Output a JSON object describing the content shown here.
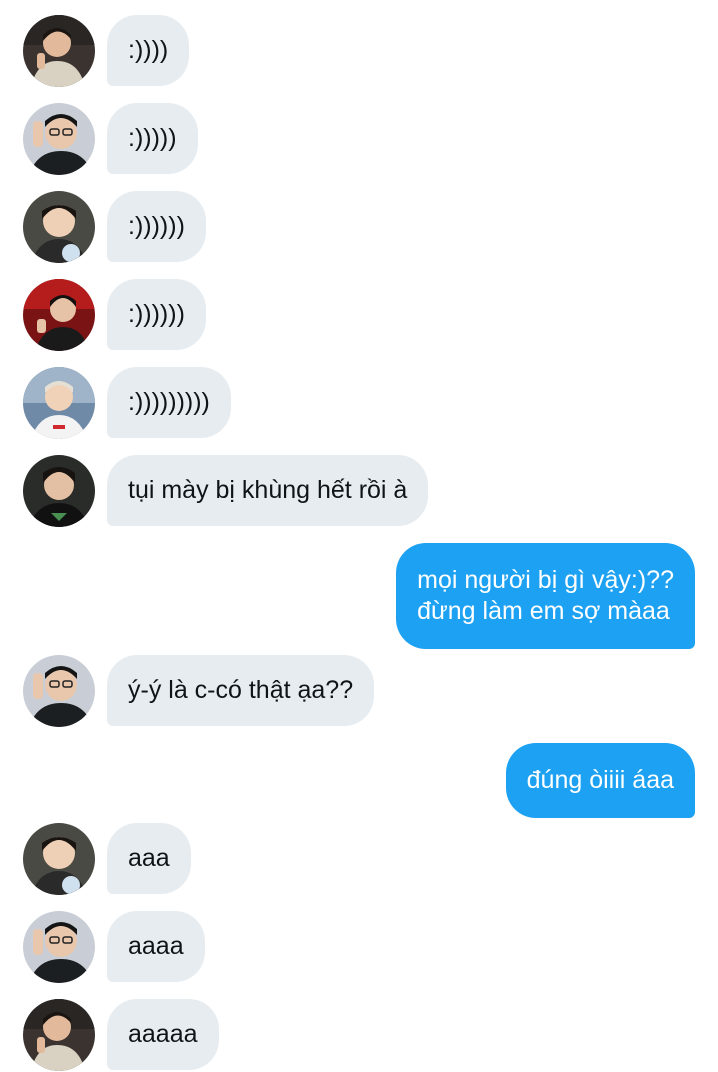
{
  "messages": [
    {
      "sender": "other",
      "text": ":))))",
      "avatar": "avatar-photo-1"
    },
    {
      "sender": "other",
      "text": ":)))))",
      "avatar": "avatar-photo-2"
    },
    {
      "sender": "other",
      "text": ":))))))",
      "avatar": "avatar-photo-3"
    },
    {
      "sender": "other",
      "text": ":))))))",
      "avatar": "avatar-photo-4"
    },
    {
      "sender": "other",
      "text": ":)))))))))",
      "avatar": "avatar-photo-5"
    },
    {
      "sender": "other",
      "text": "tụi mày bị khùng hết rồi à",
      "avatar": "avatar-photo-6"
    },
    {
      "sender": "me",
      "line1": "mọi người bị gì vậy:)??",
      "line2": "đừng làm em sợ màaa"
    },
    {
      "sender": "other",
      "text": "ý-ý là c-có thật ạa??",
      "avatar": "avatar-photo-2"
    },
    {
      "sender": "me",
      "text": "đúng òiiii áaa"
    },
    {
      "sender": "other",
      "text": "aaa",
      "avatar": "avatar-photo-3"
    },
    {
      "sender": "other",
      "text": "aaaa",
      "avatar": "avatar-photo-2"
    },
    {
      "sender": "other",
      "text": "aaaaa",
      "avatar": "avatar-photo-1"
    }
  ],
  "colors": {
    "incoming_bubble": "#e7ecf0",
    "outgoing_bubble": "#1da1f2",
    "incoming_text": "#0f1419",
    "outgoing_text": "#ffffff"
  }
}
